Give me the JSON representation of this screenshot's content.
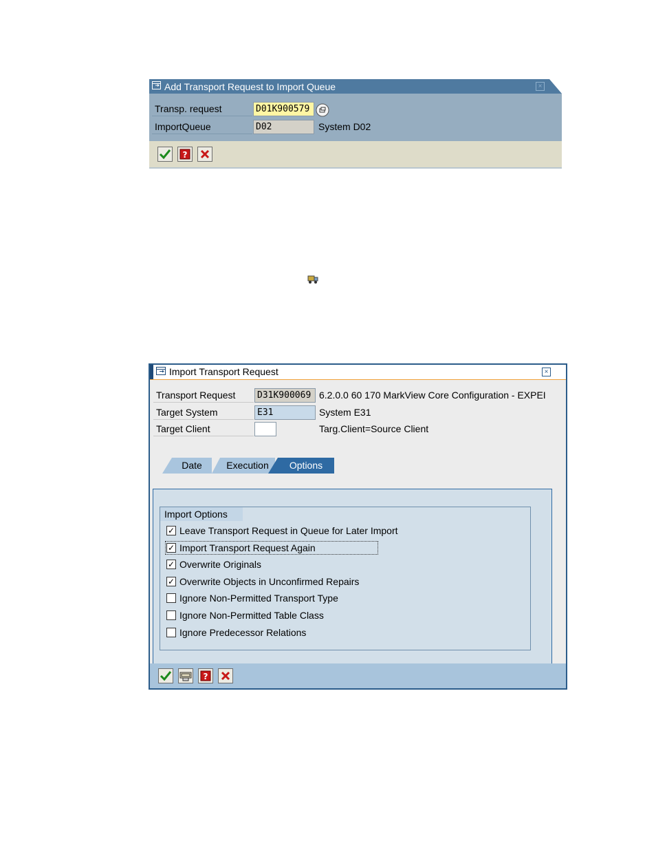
{
  "dialog1": {
    "title": "Add Transport Request to Import Queue",
    "fields": {
      "transp_request_label": "Transp. request",
      "transp_request_value": "D01K900579",
      "import_queue_label": "ImportQueue",
      "import_queue_value": "D02",
      "import_queue_desc": "System D02"
    }
  },
  "dialog2": {
    "title": "Import Transport Request",
    "fields": {
      "transport_request_label": "Transport Request",
      "transport_request_value": "D31K900069",
      "transport_request_desc": "6.2.0.0 60 170 MarkView Core Configuration - EXPEI",
      "target_system_label": "Target System",
      "target_system_value": "E31",
      "target_system_desc": "System E31",
      "target_client_label": "Target Client",
      "target_client_value": "",
      "target_client_desc": "Targ.Client=Source Client"
    },
    "tabs": [
      {
        "label": "Date",
        "active": false
      },
      {
        "label": "Execution",
        "active": false
      },
      {
        "label": "Options",
        "active": true
      }
    ],
    "group_title": "Import Options",
    "options": [
      {
        "label": "Leave Transport Request in Queue for Later Import",
        "checked": true
      },
      {
        "label": "Import Transport Request Again",
        "checked": true
      },
      {
        "label": "Overwrite Originals",
        "checked": true
      },
      {
        "label": "Overwrite Objects in Unconfirmed Repairs",
        "checked": true
      },
      {
        "label": "Ignore Non-Permitted Transport Type",
        "checked": false
      },
      {
        "label": "Ignore Non-Permitted Table Class",
        "checked": false
      },
      {
        "label": "Ignore Predecessor Relations",
        "checked": false
      }
    ]
  },
  "colors": {
    "sap_blue": "#2e6aa3",
    "dialog1_body": "#96adc0",
    "yellow_input": "#fff6a4",
    "orange_accent": "#f1a13a"
  },
  "icons": [
    "window-icon",
    "close-icon",
    "search-help-icon",
    "check-icon",
    "help-icon",
    "cancel-icon",
    "truck-icon",
    "import-icon"
  ]
}
